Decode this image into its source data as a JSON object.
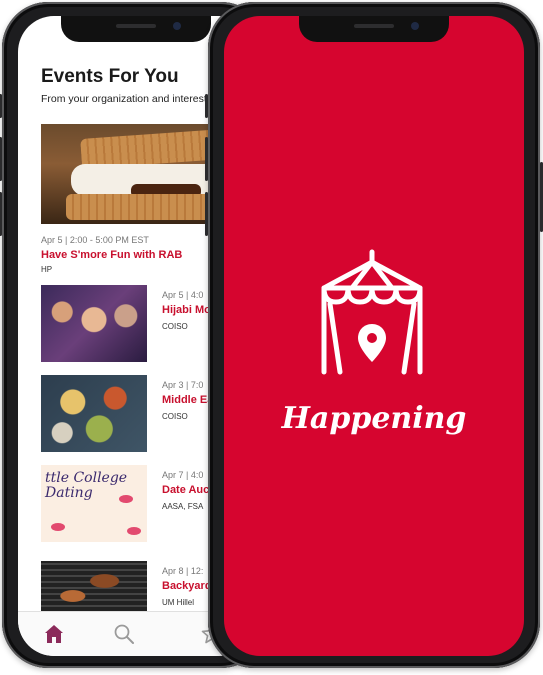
{
  "events_screen": {
    "title": "Events For You",
    "subtitle": "From your organization and interests",
    "featured": {
      "date": "Apr 5 | 2:00 - 5:00 PM EST",
      "name": "Have S'more Fun with RAB",
      "org": "HP"
    },
    "items": [
      {
        "date": "Apr 5 | 4:0",
        "name": "Hijabi Mon",
        "org": "COISO"
      },
      {
        "date": "Apr 3 | 7:0",
        "name": "Middle Ea",
        "org": "COISO"
      },
      {
        "date": "Apr 7 | 4:0",
        "name": "Date Aucti",
        "org": "AASA, FSA"
      },
      {
        "date": "Apr 8 | 12:",
        "name": "Backyard",
        "org": "UM Hillel"
      }
    ],
    "dating_thumb_text": "ttle College Dating",
    "tabs": [
      {
        "name": "home",
        "icon": "home-icon"
      },
      {
        "name": "search",
        "icon": "search-icon"
      },
      {
        "name": "favorites",
        "icon": "star-icon"
      }
    ]
  },
  "splash_screen": {
    "app_name": "Happening",
    "logo_icon": "tent-location-pin-icon",
    "background_color": "#d6052f"
  },
  "colors": {
    "accent": "#c8102e",
    "tab_active": "#8b2a5a",
    "tab_inactive": "#9a9a9a"
  }
}
